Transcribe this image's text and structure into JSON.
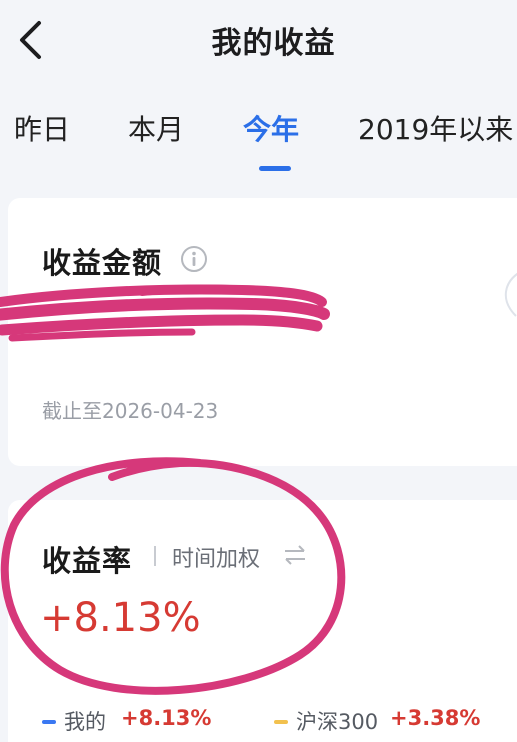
{
  "header": {
    "title": "我的收益",
    "back_icon": "chevron-left-icon"
  },
  "tabs": [
    {
      "label": "昨日",
      "active": false
    },
    {
      "label": "本月",
      "active": false
    },
    {
      "label": "今年",
      "active": true
    },
    {
      "label": "2019年以来",
      "active": false
    }
  ],
  "amount_card": {
    "title": "收益金额",
    "info_icon": "info-icon",
    "amount": "",
    "as_of": "截止至2026-04-23"
  },
  "rate_card": {
    "title": "收益率",
    "mode": "时间加权",
    "mode_icon": "swap-icon",
    "value": "+8.13%",
    "legend": [
      {
        "label": "我的",
        "value": "+8.13%",
        "color": "#3a78f2"
      },
      {
        "label": "沪深300",
        "value": "+3.38%",
        "color": "#f2c14e"
      }
    ]
  },
  "colors": {
    "accent": "#2b6fe8",
    "gain": "#d63a33",
    "annotation": "#d6387a"
  }
}
